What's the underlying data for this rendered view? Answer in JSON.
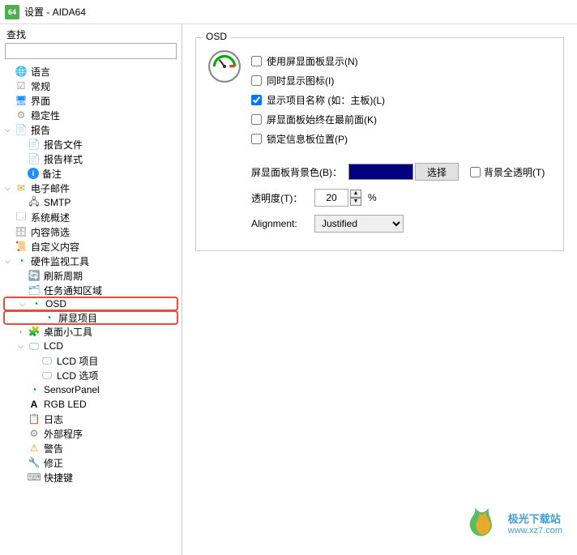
{
  "window": {
    "title": "设置 - AIDA64",
    "icon": "64"
  },
  "search": {
    "label": "查找"
  },
  "tree": [
    {
      "lvl": 0,
      "exp": "",
      "ico": "globe",
      "lbl": "语言"
    },
    {
      "lvl": 0,
      "exp": "",
      "ico": "check",
      "lbl": "常规"
    },
    {
      "lvl": 0,
      "exp": "",
      "ico": "monitor",
      "lbl": "界面"
    },
    {
      "lvl": 0,
      "exp": "",
      "ico": "gear",
      "lbl": "稳定性"
    },
    {
      "lvl": 0,
      "exp": "v",
      "ico": "doc",
      "lbl": "报告"
    },
    {
      "lvl": 1,
      "exp": "",
      "ico": "doc",
      "lbl": "报告文件"
    },
    {
      "lvl": 1,
      "exp": "",
      "ico": "doc",
      "lbl": "报告样式"
    },
    {
      "lvl": 1,
      "exp": "",
      "ico": "info",
      "lbl": "备注"
    },
    {
      "lvl": 0,
      "exp": "v",
      "ico": "mail",
      "lbl": "电子邮件"
    },
    {
      "lvl": 1,
      "exp": "",
      "ico": "network",
      "lbl": "SMTP"
    },
    {
      "lvl": 0,
      "exp": "",
      "ico": "summary",
      "lbl": "系统概述"
    },
    {
      "lvl": 0,
      "exp": "",
      "ico": "server",
      "lbl": "内容筛选"
    },
    {
      "lvl": 0,
      "exp": "",
      "ico": "scroll",
      "lbl": "自定义内容"
    },
    {
      "lvl": 0,
      "exp": "v",
      "ico": "gauge",
      "lbl": "硬件监视工具"
    },
    {
      "lvl": 1,
      "exp": "",
      "ico": "refresh",
      "lbl": "刷新周期"
    },
    {
      "lvl": 1,
      "exp": "",
      "ico": "task",
      "lbl": "任务通知区域"
    },
    {
      "lvl": 1,
      "exp": "v",
      "ico": "osd",
      "lbl": "OSD",
      "hl": true
    },
    {
      "lvl": 2,
      "exp": "",
      "ico": "osd",
      "lbl": "屏显项目",
      "hl": true
    },
    {
      "lvl": 1,
      "exp": ">",
      "ico": "widget",
      "lbl": "桌面小工具"
    },
    {
      "lvl": 1,
      "exp": "v",
      "ico": "lcd",
      "lbl": "LCD"
    },
    {
      "lvl": 2,
      "exp": "",
      "ico": "lcd",
      "lbl": "LCD 项目"
    },
    {
      "lvl": 2,
      "exp": "",
      "ico": "lcd",
      "lbl": "LCD 选项"
    },
    {
      "lvl": 1,
      "exp": "",
      "ico": "panel",
      "lbl": "SensorPanel"
    },
    {
      "lvl": 1,
      "exp": "",
      "ico": "rgb",
      "lbl": "RGB LED"
    },
    {
      "lvl": 1,
      "exp": "",
      "ico": "log",
      "lbl": "日志"
    },
    {
      "lvl": 1,
      "exp": "",
      "ico": "ext",
      "lbl": "外部程序"
    },
    {
      "lvl": 1,
      "exp": "",
      "ico": "warn",
      "lbl": "警告"
    },
    {
      "lvl": 1,
      "exp": "",
      "ico": "fix",
      "lbl": "修正"
    },
    {
      "lvl": 1,
      "exp": "",
      "ico": "kb",
      "lbl": "快捷键"
    }
  ],
  "osd": {
    "groupTitle": "OSD",
    "checks": [
      {
        "lbl": "使用屏显面板显示(N)",
        "checked": false
      },
      {
        "lbl": "同时显示图标(I)",
        "checked": false
      },
      {
        "lbl": "显示项目名称 (如：主板)(L)",
        "checked": true
      },
      {
        "lbl": "屏显面板始终在最前面(K)",
        "checked": false
      },
      {
        "lbl": "锁定信息板位置(P)",
        "checked": false
      }
    ],
    "bgLabel": "屏显面板背景色(B)：",
    "bgColor": "#000080",
    "chooseBtn": "选择",
    "transparentLabel": "背景全透明(T)",
    "transparentChecked": false,
    "opacityLabel": "透明度(T)：",
    "opacityValue": "20",
    "opacityUnit": "%",
    "alignLabel": "Alignment:",
    "alignValue": "Justified"
  },
  "footer": {
    "brand": "极光下载站",
    "url": "www.xz7.com"
  }
}
